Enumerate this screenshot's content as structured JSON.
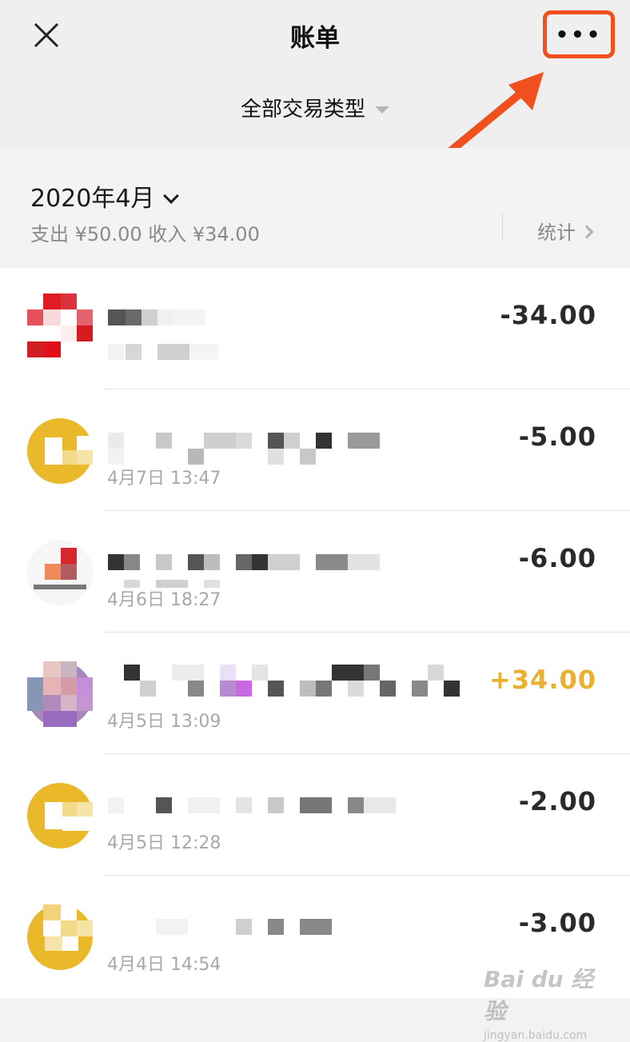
{
  "header": {
    "close_icon": "close-icon",
    "title": "账单",
    "more_icon": "more-icon",
    "more_label": "•••",
    "filter_label": "全部交易类型",
    "accent": "#f0501e"
  },
  "summary": {
    "month": "2020年4月",
    "totals": "支出 ¥50.00 收入 ¥34.00",
    "stats_label": "统计"
  },
  "transactions": [
    {
      "date": "",
      "amount": "-34.00",
      "kind": "expense"
    },
    {
      "date": "4月7日 13:47",
      "amount": "-5.00",
      "kind": "expense"
    },
    {
      "date": "4月6日 18:27",
      "amount": "-6.00",
      "kind": "expense"
    },
    {
      "date": "4月5日 13:09",
      "amount": "+34.00",
      "kind": "income"
    },
    {
      "date": "4月5日 12:28",
      "amount": "-2.00",
      "kind": "expense"
    },
    {
      "date": "4月4日 14:54",
      "amount": "-3.00",
      "kind": "expense"
    }
  ],
  "colors": {
    "income": "#eab130",
    "expense": "#2a2a2a"
  },
  "watermark": {
    "main": "Bai du 经验",
    "sub": "jingyan.baidu.com"
  }
}
